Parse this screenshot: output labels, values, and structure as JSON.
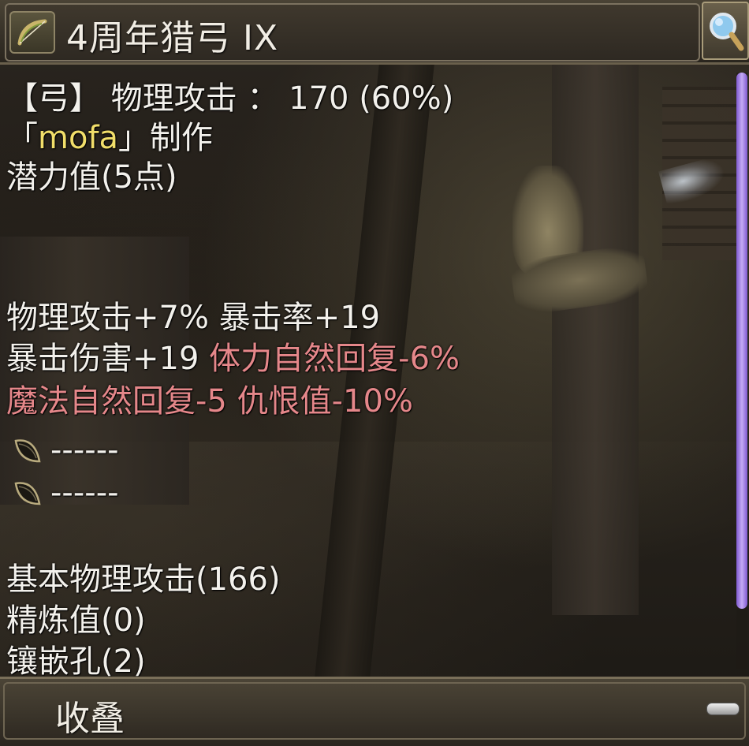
{
  "header": {
    "title": "4周年猎弓 IX",
    "bow_icon": "bow-icon",
    "search_icon": "magnifier-icon"
  },
  "details": {
    "type_line": "【弓】 物理攻击 ：  170 (60%)",
    "crafter_open": "「",
    "crafter_name": "mofa",
    "crafter_close": "」制作",
    "potential": "潜力值(5点)"
  },
  "bonuses": {
    "row1": {
      "a": "物理攻击+7%",
      "b": "暴击率+19"
    },
    "row2": {
      "a": "暴击伤害+19",
      "b": "体力自然回复-6%"
    },
    "row3": {
      "a": "魔法自然回复-5",
      "b": "仇恨值-10%"
    }
  },
  "slots": [
    {
      "icon": "seed-slot-icon",
      "text": "------"
    },
    {
      "icon": "seed-slot-icon",
      "text": "------"
    }
  ],
  "stats": {
    "base_attack": "基本物理攻击(166)",
    "refine": "精炼值(0)",
    "sockets": "镶嵌孔(2)"
  },
  "footer": {
    "collapse_label": "收叠"
  },
  "colors": {
    "text": "#f3f1ec",
    "negative": "#e5878a",
    "crafter": "#f1de6a",
    "scrollbar": "#b79bf0"
  }
}
